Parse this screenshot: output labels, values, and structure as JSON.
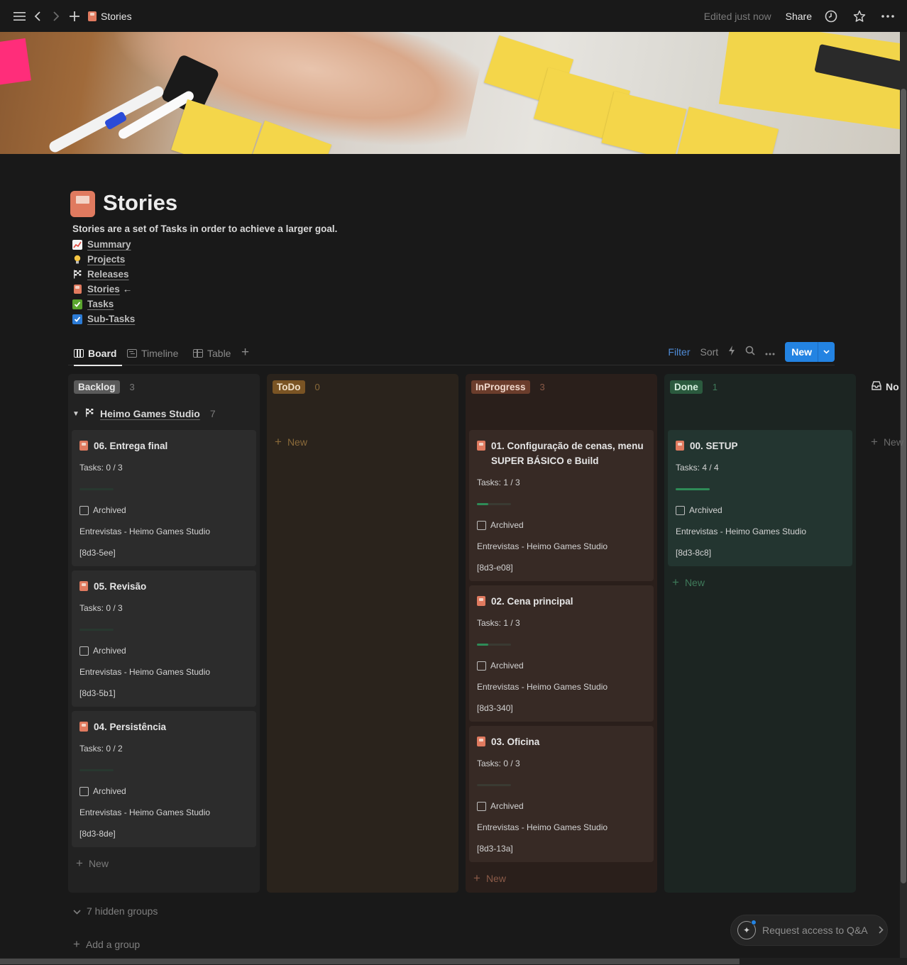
{
  "topbar": {
    "breadcrumb": "Stories",
    "edited": "Edited just now",
    "share": "Share",
    "icons": [
      "menu-icon",
      "back-icon",
      "forward-icon",
      "plus-icon",
      "clock-icon",
      "star-icon",
      "more-icon"
    ]
  },
  "page": {
    "title": "Stories",
    "description": "Stories are a set of Tasks in order to achieve a larger goal.",
    "links": [
      {
        "label": "Summary",
        "icon": "📈"
      },
      {
        "label": "Projects",
        "icon": "💡"
      },
      {
        "label": "Releases",
        "icon": "🏁"
      },
      {
        "label": "Stories",
        "icon": "book",
        "suffix": "←"
      },
      {
        "label": "Tasks",
        "icon": "✅"
      },
      {
        "label": "Sub-Tasks",
        "icon": "☑️"
      }
    ]
  },
  "views": {
    "tabs": [
      {
        "label": "Board",
        "active": true
      },
      {
        "label": "Timeline",
        "active": false
      },
      {
        "label": "Table",
        "active": false
      }
    ],
    "filter": "Filter",
    "sort": "Sort",
    "new_button": "New"
  },
  "board": {
    "group": {
      "name": "Heimo Games Studio",
      "count": "7"
    },
    "columns": [
      {
        "label": "Backlog",
        "count": "3",
        "colors": {
          "pill_bg": "#5a5a5a",
          "pill_fg": "#e6e6e6",
          "col_bg": "#222222",
          "card_bg": "#2c2c2c",
          "count": "#7a7a7a",
          "new": "#7a7a7a"
        }
      },
      {
        "label": "ToDo",
        "count": "0",
        "colors": {
          "pill_bg": "#7a5424",
          "pill_fg": "#f0e0c8",
          "col_bg": "#2a231c",
          "card_bg": "#3a2f24",
          "count": "#8a6a3a",
          "new": "#8a6a3a"
        }
      },
      {
        "label": "InProgress",
        "count": "3",
        "colors": {
          "pill_bg": "#6b3d2c",
          "pill_fg": "#f0d8cc",
          "col_bg": "#2a1f1b",
          "card_bg": "#372a25",
          "count": "#8a5a48",
          "new": "#8a5a48"
        }
      },
      {
        "label": "Done",
        "count": "1",
        "colors": {
          "pill_bg": "#2b5a3e",
          "pill_fg": "#d8f0e0",
          "col_bg": "#1c2522",
          "card_bg": "#233530",
          "count": "#3f7a5a",
          "new": "#3f7a5a"
        }
      },
      {
        "label": "No",
        "count": ""
      }
    ],
    "new_label": "New",
    "cards": [
      {
        "title": "06. Entrega final",
        "tasks": "Tasks: 0 / 3",
        "progress": 0,
        "archived": "Archived",
        "project": "Entrevistas - Heimo Games Studio",
        "id": "[8d3-5ee]"
      },
      {
        "title": "05. Revisão",
        "tasks": "Tasks: 0 / 3",
        "progress": 0,
        "archived": "Archived",
        "project": "Entrevistas - Heimo Games Studio",
        "id": "[8d3-5b1]"
      },
      {
        "title": "04. Persistência",
        "tasks": "Tasks: 0 / 2",
        "progress": 0,
        "archived": "Archived",
        "project": "Entrevistas - Heimo Games Studio",
        "id": "[8d3-8de]"
      },
      {
        "title": "01. Configuração de cenas, menu SUPER BÁSICO e Build",
        "tasks": "Tasks: 1 / 3",
        "progress": 0.33,
        "archived": "Archived",
        "project": "Entrevistas - Heimo Games Studio",
        "id": "[8d3-e08]"
      },
      {
        "title": "02. Cena principal",
        "tasks": "Tasks: 1 / 3",
        "progress": 0.33,
        "archived": "Archived",
        "project": "Entrevistas - Heimo Games Studio",
        "id": "[8d3-340]"
      },
      {
        "title": "03. Oficina",
        "tasks": "Tasks: 0 / 3",
        "progress": 0,
        "archived": "Archived",
        "project": "Entrevistas - Heimo Games Studio",
        "id": "[8d3-13a]"
      },
      {
        "title": "00. SETUP",
        "tasks": "Tasks: 4 / 4",
        "progress": 1,
        "archived": "Archived",
        "project": "Entrevistas - Heimo Games Studio",
        "id": "[8d3-8c8]"
      }
    ],
    "hidden_groups": "7 hidden groups",
    "add_group": "Add a group"
  },
  "qa": {
    "label": "Request access to Q&A"
  }
}
